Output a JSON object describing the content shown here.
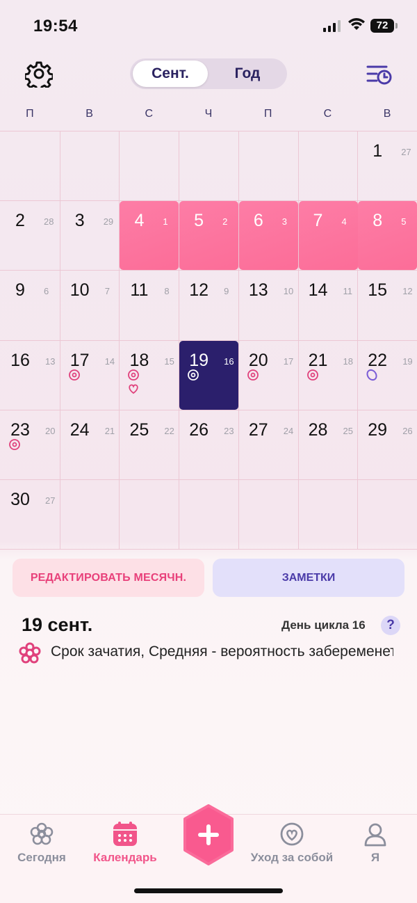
{
  "status_bar": {
    "time": "19:54",
    "battery": "72"
  },
  "header": {
    "segments": [
      {
        "label": "Сент.",
        "active": true
      },
      {
        "label": "Год",
        "active": false
      }
    ]
  },
  "weekdays": [
    "П",
    "В",
    "С",
    "Ч",
    "П",
    "С",
    "В"
  ],
  "calendar": {
    "days": [
      {
        "d": "1",
        "c": "27",
        "row": 0,
        "col": 6
      },
      {
        "d": "2",
        "c": "28",
        "row": 1,
        "col": 0
      },
      {
        "d": "3",
        "c": "29",
        "row": 1,
        "col": 1
      },
      {
        "d": "4",
        "c": "1",
        "row": 1,
        "col": 2,
        "state": "period"
      },
      {
        "d": "5",
        "c": "2",
        "row": 1,
        "col": 3,
        "state": "period"
      },
      {
        "d": "6",
        "c": "3",
        "row": 1,
        "col": 4,
        "state": "period"
      },
      {
        "d": "7",
        "c": "4",
        "row": 1,
        "col": 5,
        "state": "period"
      },
      {
        "d": "8",
        "c": "5",
        "row": 1,
        "col": 6,
        "state": "period"
      },
      {
        "d": "9",
        "c": "6",
        "row": 2,
        "col": 0
      },
      {
        "d": "10",
        "c": "7",
        "row": 2,
        "col": 1
      },
      {
        "d": "11",
        "c": "8",
        "row": 2,
        "col": 2
      },
      {
        "d": "12",
        "c": "9",
        "row": 2,
        "col": 3
      },
      {
        "d": "13",
        "c": "10",
        "row": 2,
        "col": 4
      },
      {
        "d": "14",
        "c": "11",
        "row": 2,
        "col": 5
      },
      {
        "d": "15",
        "c": "12",
        "row": 2,
        "col": 6
      },
      {
        "d": "16",
        "c": "13",
        "row": 3,
        "col": 0
      },
      {
        "d": "17",
        "c": "14",
        "row": 3,
        "col": 1,
        "markers": [
          "fertile"
        ]
      },
      {
        "d": "18",
        "c": "15",
        "row": 3,
        "col": 2,
        "markers": [
          "fertile",
          "heart"
        ]
      },
      {
        "d": "19",
        "c": "16",
        "row": 3,
        "col": 3,
        "state": "today",
        "markers": [
          "fertile"
        ]
      },
      {
        "d": "20",
        "c": "17",
        "row": 3,
        "col": 4,
        "markers": [
          "fertile"
        ]
      },
      {
        "d": "21",
        "c": "18",
        "row": 3,
        "col": 5,
        "markers": [
          "fertile"
        ]
      },
      {
        "d": "22",
        "c": "19",
        "row": 3,
        "col": 6,
        "markers": [
          "egg"
        ]
      },
      {
        "d": "23",
        "c": "20",
        "row": 4,
        "col": 0,
        "markers": [
          "fertile"
        ]
      },
      {
        "d": "24",
        "c": "21",
        "row": 4,
        "col": 1
      },
      {
        "d": "25",
        "c": "22",
        "row": 4,
        "col": 2
      },
      {
        "d": "26",
        "c": "23",
        "row": 4,
        "col": 3
      },
      {
        "d": "27",
        "c": "24",
        "row": 4,
        "col": 4
      },
      {
        "d": "28",
        "c": "25",
        "row": 4,
        "col": 5
      },
      {
        "d": "29",
        "c": "26",
        "row": 4,
        "col": 6
      },
      {
        "d": "30",
        "c": "27",
        "row": 5,
        "col": 0
      }
    ]
  },
  "actions": {
    "edit_period": "РЕДАКТИРОВАТЬ МЕСЯЧН.",
    "notes": "ЗАМЕТКИ"
  },
  "selected": {
    "date": "19 сент.",
    "cycle_day": "День цикла 16",
    "help": "?",
    "info": "Срок зачатия, Средняя - вероятность забеременеть"
  },
  "tabs": [
    {
      "label": "Сегодня",
      "icon": "today-flower-icon",
      "active": false
    },
    {
      "label": "Календарь",
      "icon": "calendar-icon",
      "active": true
    },
    {
      "label": "Уход за собой",
      "icon": "self-care-heart-icon",
      "active": false
    },
    {
      "label": "Я",
      "icon": "profile-icon",
      "active": false
    }
  ],
  "colors": {
    "period": "#fc6d98",
    "today": "#2b1f6c",
    "accent": "#f1558a",
    "fertile": "#e0417c",
    "egg": "#7a5cd6"
  }
}
